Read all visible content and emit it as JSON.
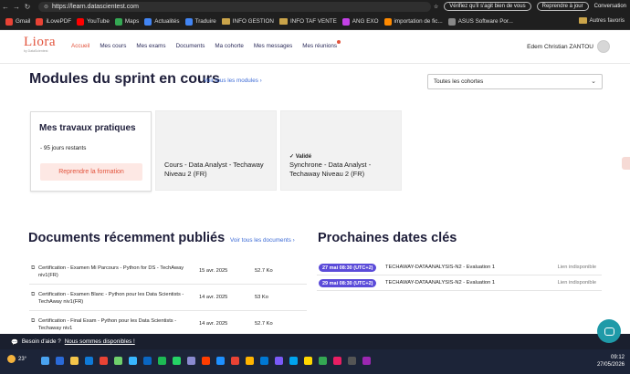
{
  "browser": {
    "url": "https://learn.datascientest.com",
    "search_pill": "Vérifiez qu'il s'agit bien de vous",
    "resume": "Reprendre à jour",
    "conversation": "Conversation",
    "bookmarks": [
      "Gmail",
      "iLovePDF",
      "YouTube",
      "Maps",
      "Actualités",
      "Traduire",
      "INFO GESTION",
      "INFO TAF VENTE",
      "ANG EXO",
      "importation de fic...",
      "ASUS Software Por..."
    ],
    "other_favs": "Autres favoris",
    "bookmark_colors": [
      "#e94335",
      "#e94335",
      "#ff0000",
      "#34a853",
      "#4285f4",
      "#4285f4",
      "#caa44a",
      "#caa44a",
      "#c341e6",
      "#ff8a00",
      "#1a1a1a"
    ]
  },
  "header": {
    "logo": "Liora",
    "logo_sub": "by DataScientest",
    "nav": [
      "Accueil",
      "Mes cours",
      "Mes exams",
      "Documents",
      "Ma cohorte",
      "Mes messages",
      "Mes réunions"
    ],
    "user_name": "Edem Christian ZANTOU"
  },
  "modules": {
    "title": "Modules du sprint en cours",
    "see_all": "Voir tous les modules",
    "filter": "Toutes les cohortes",
    "work_card": {
      "title": "Mes travaux pratiques",
      "remaining": "- 95 jours restants",
      "button": "Reprendre la formation"
    },
    "course_card": {
      "text": "Cours - Data Analyst - Techaway Niveau 2 (FR)"
    },
    "sync_card": {
      "status": "Validé",
      "text": "Synchrone - Data Analyst - Techaway Niveau 2 (FR)"
    }
  },
  "documents": {
    "title": "Documents récemment publiés",
    "see_all": "Voir tous les documents",
    "rows": [
      {
        "title": "Certification - Examen Mi Parcours - Python for DS - TechAway niv1(FR)",
        "date": "15 avr. 2025",
        "size": "52.7 Ko"
      },
      {
        "title": "Certification - Examen Blanc - Python pour les Data Scientists - TechAway niv1(FR)",
        "date": "14 avr. 2025",
        "size": "53 Ko"
      },
      {
        "title": "Certification - Final Exam - Python pour les Data Scientists - Techaway niv1",
        "date": "14 avr. 2025",
        "size": "52.7 Ko"
      }
    ]
  },
  "dates": {
    "title": "Prochaines dates clés",
    "rows": [
      {
        "badge": "27 mai 08:30 (UTC+2)",
        "text": "TECHAWAY-DATAANALYSIS-N2 - Evaluation 1",
        "status": "Lien indisponible"
      },
      {
        "badge": "29 mai 08:30 (UTC+2)",
        "text": "TECHAWAY-DATAANALYSIS-N2 - Evaluation 1",
        "status": "Lien indisponible"
      }
    ]
  },
  "help": {
    "prefix": "Besoin d'aide ?",
    "link": "Nous sommes disponibles !"
  },
  "taskbar": {
    "temperature": "23°",
    "time": "09:12",
    "date": "27/05/2026",
    "icon_colors": [
      "#4aa3f0",
      "#2a6ad8",
      "#f4c54a",
      "#0f7ad8",
      "#e94335",
      "#6fd06c",
      "#38b6ff",
      "#0a66c2",
      "#1db954",
      "#25d366",
      "#8a8ad0",
      "#ff3d00",
      "#1e90ff",
      "#e94335",
      "#ffb400",
      "#0078d4",
      "#7a5af8",
      "#00a4ef",
      "#ffd700",
      "#34a853",
      "#e91e63",
      "#555555",
      "#9c27b0"
    ]
  }
}
